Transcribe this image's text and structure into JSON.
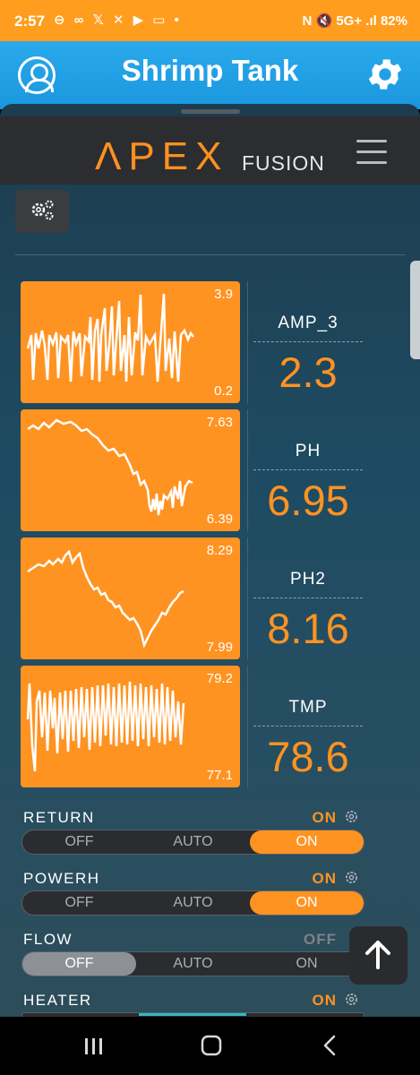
{
  "status_bar": {
    "time": "2:57",
    "left_icons": "⊖ ∞ 𝕏 ✕ ▶ ▭ •",
    "right_icons": "N 🔇 5G+ .ıl",
    "battery": "82%"
  },
  "header": {
    "title": "Shrimp Tank",
    "left_icon": "user-icon",
    "right_icon": "gear-icon"
  },
  "brand": {
    "logo": "ΛPEX",
    "sub": "FUSION"
  },
  "probes": [
    {
      "name": "AMP_3",
      "value": "2.3",
      "graph_max": "3.9",
      "graph_min": "0.2"
    },
    {
      "name": "PH",
      "value": "6.95",
      "graph_max": "7.63",
      "graph_min": "6.39"
    },
    {
      "name": "PH2",
      "value": "8.16",
      "graph_max": "8.29",
      "graph_min": "7.99"
    },
    {
      "name": "TMP",
      "value": "78.6",
      "graph_max": "79.2",
      "graph_min": "77.1"
    }
  ],
  "outlets": [
    {
      "name": "RETURN",
      "state": "ON",
      "selected": "ON"
    },
    {
      "name": "POWERH",
      "state": "ON",
      "selected": "ON"
    },
    {
      "name": "FLOW",
      "state": "OFF",
      "selected": "OFF"
    },
    {
      "name": "HEATER",
      "state": "ON",
      "selected": "AUTO"
    }
  ],
  "toggle_labels": {
    "off": "OFF",
    "auto": "AUTO",
    "on": "ON"
  },
  "colors": {
    "accent": "#ff9322",
    "header": "#1fa0e4",
    "status_bar": "#ff9d1e",
    "off_state": "#8d9196"
  }
}
